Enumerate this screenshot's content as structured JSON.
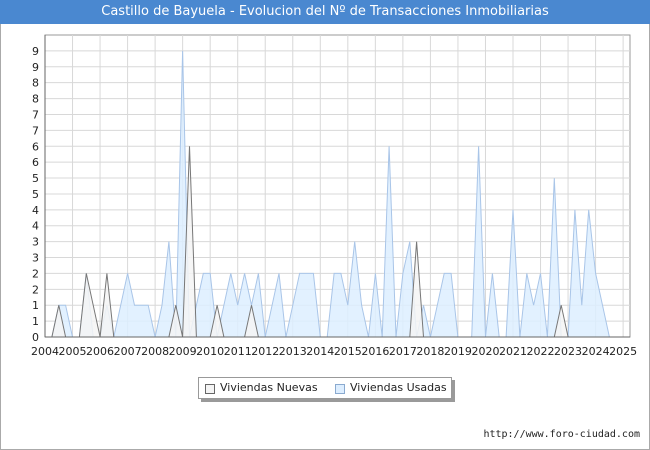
{
  "page": {
    "title": "Castillo de Bayuela - Evolucion del Nº de Transacciones Inmobiliarias",
    "source": "http://www.foro-ciudad.com"
  },
  "colors": {
    "title_bg": "#4a88d0",
    "nuevas_fill": "#f4f4f4",
    "nuevas_line": "#777777",
    "usadas_fill": "#ddeeff",
    "usadas_line": "#a9c5e8",
    "grid": "#d8d8d8"
  },
  "chart_data": {
    "type": "area",
    "title": "Castillo de Bayuela - Evolucion del Nº de Transacciones Inmobiliarias",
    "xlabel": "",
    "ylabel": "",
    "x_ticks": [
      "2004",
      "2005",
      "2006",
      "2007",
      "2008",
      "2009",
      "2010",
      "2011",
      "2012",
      "2013",
      "2014",
      "2015",
      "2016",
      "2017",
      "2018",
      "2019",
      "2020",
      "2021",
      "2022",
      "2023",
      "2024",
      "2025"
    ],
    "y_ticks": [
      "0",
      "1",
      "1",
      "2",
      "2",
      "3",
      "3",
      "4",
      "4",
      "5",
      "5",
      "6",
      "6",
      "7",
      "7",
      "8",
      "8",
      "9",
      "9"
    ],
    "ylim": [
      0,
      9.5
    ],
    "xlim": [
      2004,
      2025.25
    ],
    "grid": true,
    "legend_position": "bottom",
    "series": [
      {
        "name": "Viviendas Nuevas",
        "color": "#777777",
        "points": [
          [
            2004,
            0
          ],
          [
            2004.25,
            0
          ],
          [
            2004.5,
            1
          ],
          [
            2004.75,
            0
          ],
          [
            2005,
            0
          ],
          [
            2005.25,
            0
          ],
          [
            2005.5,
            2
          ],
          [
            2005.75,
            1
          ],
          [
            2006,
            0
          ],
          [
            2006.25,
            2
          ],
          [
            2006.5,
            0
          ],
          [
            2006.75,
            0
          ],
          [
            2007,
            0
          ],
          [
            2007.25,
            0
          ],
          [
            2007.5,
            0
          ],
          [
            2007.75,
            0
          ],
          [
            2008,
            0
          ],
          [
            2008.25,
            0
          ],
          [
            2008.5,
            0
          ],
          [
            2008.75,
            1
          ],
          [
            2009,
            0
          ],
          [
            2009.25,
            6
          ],
          [
            2009.5,
            0
          ],
          [
            2009.75,
            0
          ],
          [
            2010,
            0
          ],
          [
            2010.25,
            1
          ],
          [
            2010.5,
            0
          ],
          [
            2010.75,
            0
          ],
          [
            2011,
            0
          ],
          [
            2011.25,
            0
          ],
          [
            2011.5,
            1
          ],
          [
            2011.75,
            0
          ],
          [
            2012,
            0
          ],
          [
            2012.25,
            0
          ],
          [
            2012.5,
            0
          ],
          [
            2012.75,
            0
          ],
          [
            2013,
            0
          ],
          [
            2013.25,
            0
          ],
          [
            2013.5,
            0
          ],
          [
            2013.75,
            0
          ],
          [
            2014,
            0
          ],
          [
            2014.25,
            0
          ],
          [
            2014.5,
            0
          ],
          [
            2014.75,
            0
          ],
          [
            2015,
            0
          ],
          [
            2015.25,
            0
          ],
          [
            2015.5,
            0
          ],
          [
            2015.75,
            0
          ],
          [
            2016,
            0
          ],
          [
            2016.25,
            0
          ],
          [
            2016.5,
            0
          ],
          [
            2016.75,
            0
          ],
          [
            2017,
            0
          ],
          [
            2017.25,
            0
          ],
          [
            2017.5,
            3
          ],
          [
            2017.75,
            0
          ],
          [
            2018,
            0
          ],
          [
            2018.25,
            0
          ],
          [
            2018.5,
            0
          ],
          [
            2018.75,
            0
          ],
          [
            2019,
            0
          ],
          [
            2019.25,
            0
          ],
          [
            2019.5,
            0
          ],
          [
            2019.75,
            0
          ],
          [
            2020,
            0
          ],
          [
            2020.25,
            0
          ],
          [
            2020.5,
            0
          ],
          [
            2020.75,
            0
          ],
          [
            2021,
            0
          ],
          [
            2021.25,
            0
          ],
          [
            2021.5,
            0
          ],
          [
            2021.75,
            0
          ],
          [
            2022,
            0
          ],
          [
            2022.25,
            0
          ],
          [
            2022.5,
            0
          ],
          [
            2022.75,
            1
          ],
          [
            2023,
            0
          ],
          [
            2023.25,
            0
          ],
          [
            2023.5,
            0
          ],
          [
            2023.75,
            0
          ],
          [
            2024,
            0
          ],
          [
            2024.25,
            0
          ],
          [
            2024.5,
            0
          ],
          [
            2024.75,
            0
          ],
          [
            2025,
            0
          ],
          [
            2025.25,
            0
          ]
        ]
      },
      {
        "name": "Viviendas Usadas",
        "color": "#a9c5e8",
        "points": [
          [
            2004,
            0
          ],
          [
            2004.25,
            0
          ],
          [
            2004.5,
            1
          ],
          [
            2004.75,
            1
          ],
          [
            2005,
            0
          ],
          [
            2005.25,
            0
          ],
          [
            2005.5,
            2
          ],
          [
            2005.75,
            0
          ],
          [
            2006,
            0
          ],
          [
            2006.25,
            1
          ],
          [
            2006.5,
            0
          ],
          [
            2006.75,
            1
          ],
          [
            2007,
            2
          ],
          [
            2007.25,
            1
          ],
          [
            2007.5,
            1
          ],
          [
            2007.75,
            1
          ],
          [
            2008,
            0
          ],
          [
            2008.25,
            1
          ],
          [
            2008.5,
            3
          ],
          [
            2008.75,
            0
          ],
          [
            2009,
            9
          ],
          [
            2009.25,
            0
          ],
          [
            2009.5,
            1
          ],
          [
            2009.75,
            2
          ],
          [
            2010,
            2
          ],
          [
            2010.25,
            0
          ],
          [
            2010.5,
            1
          ],
          [
            2010.75,
            2
          ],
          [
            2011,
            1
          ],
          [
            2011.25,
            2
          ],
          [
            2011.5,
            1
          ],
          [
            2011.75,
            2
          ],
          [
            2012,
            0
          ],
          [
            2012.25,
            1
          ],
          [
            2012.5,
            2
          ],
          [
            2012.75,
            0
          ],
          [
            2013,
            1
          ],
          [
            2013.25,
            2
          ],
          [
            2013.5,
            2
          ],
          [
            2013.75,
            2
          ],
          [
            2014,
            0
          ],
          [
            2014.25,
            0
          ],
          [
            2014.5,
            2
          ],
          [
            2014.75,
            2
          ],
          [
            2015,
            1
          ],
          [
            2015.25,
            3
          ],
          [
            2015.5,
            1
          ],
          [
            2015.75,
            0
          ],
          [
            2016,
            2
          ],
          [
            2016.25,
            0
          ],
          [
            2016.5,
            6
          ],
          [
            2016.75,
            0
          ],
          [
            2017,
            2
          ],
          [
            2017.25,
            3
          ],
          [
            2017.5,
            0
          ],
          [
            2017.75,
            1
          ],
          [
            2018,
            0
          ],
          [
            2018.25,
            1
          ],
          [
            2018.5,
            2
          ],
          [
            2018.75,
            2
          ],
          [
            2019,
            0
          ],
          [
            2019.25,
            0
          ],
          [
            2019.5,
            0
          ],
          [
            2019.75,
            6
          ],
          [
            2020,
            0
          ],
          [
            2020.25,
            2
          ],
          [
            2020.5,
            0
          ],
          [
            2020.75,
            0
          ],
          [
            2021,
            4
          ],
          [
            2021.25,
            0
          ],
          [
            2021.5,
            2
          ],
          [
            2021.75,
            1
          ],
          [
            2022,
            2
          ],
          [
            2022.25,
            0
          ],
          [
            2022.5,
            5
          ],
          [
            2022.75,
            0
          ],
          [
            2023,
            0
          ],
          [
            2023.25,
            4
          ],
          [
            2023.5,
            1
          ],
          [
            2023.75,
            4
          ],
          [
            2024,
            2
          ],
          [
            2024.25,
            1
          ],
          [
            2024.5,
            0
          ],
          [
            2024.75,
            0
          ],
          [
            2025,
            0
          ],
          [
            2025.25,
            0
          ]
        ]
      }
    ]
  }
}
